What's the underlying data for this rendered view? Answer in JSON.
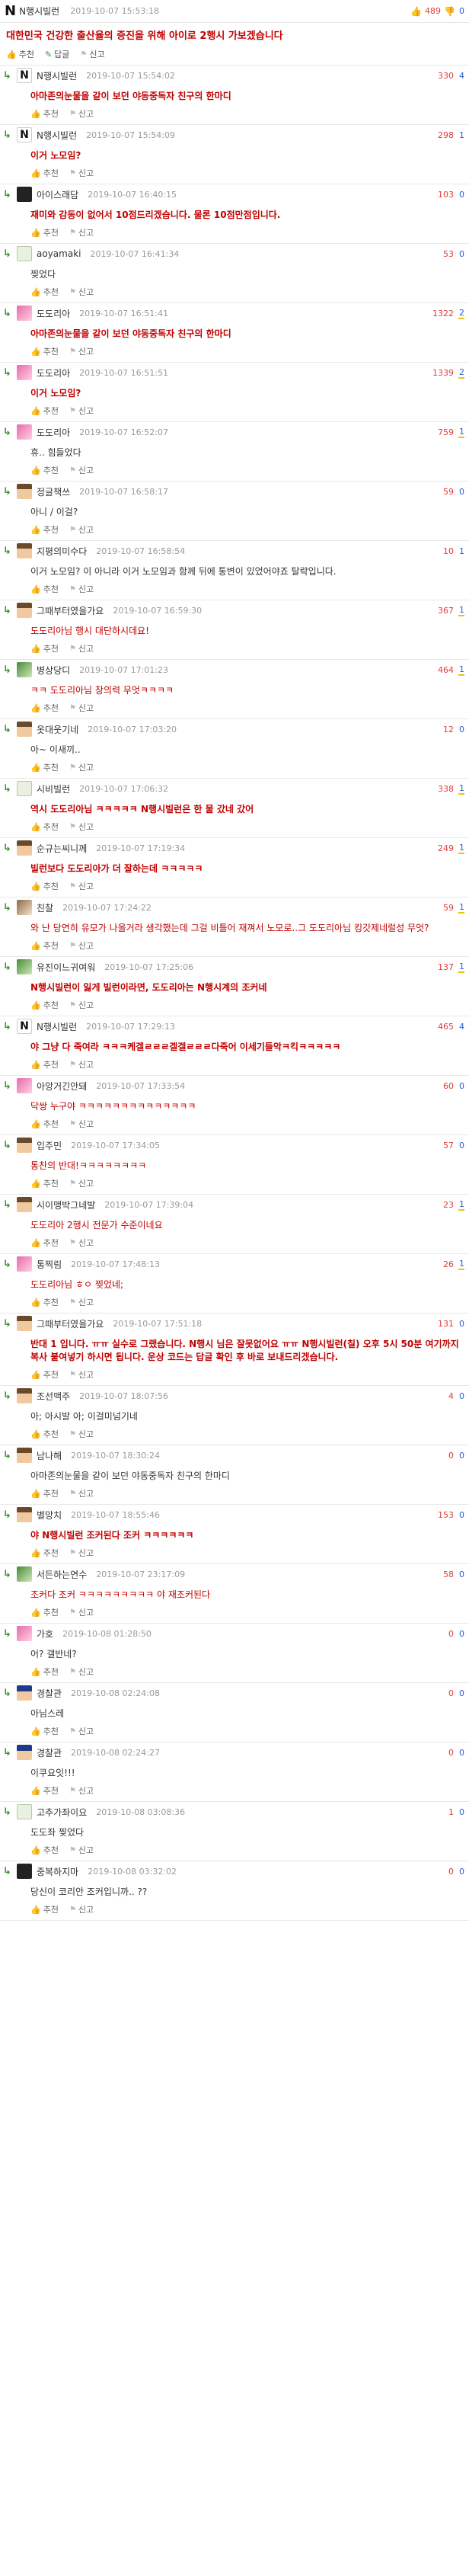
{
  "op": {
    "icon_glyph": "N",
    "nick": "N행시빌런",
    "date": "2019-10-07 15:53:18",
    "up": "489",
    "down": "0",
    "title": "대한민국 건강한 출산율의 증진을 위해 아이로 2행시 가보겠습니다",
    "actions": {
      "recommend": "추천",
      "reply": "답글",
      "report": "신고"
    }
  },
  "labels": {
    "recommend": "추천",
    "report": "신고",
    "reply_arrow": "↳"
  },
  "comments": [
    {
      "nick": "N행시빌런",
      "date": "2019-10-07 15:54:02",
      "score": "330",
      "replies": "4",
      "hl": false,
      "avatar": "n",
      "style": "red",
      "text": "아마존의눈물을 같이 보던 야동중독자 친구의 한마디"
    },
    {
      "nick": "N행시빌런",
      "date": "2019-10-07 15:54:09",
      "score": "298",
      "replies": "1",
      "hl": false,
      "avatar": "n",
      "style": "red",
      "text": "이거 노모임?"
    },
    {
      "nick": "아이스래담",
      "date": "2019-10-07 16:40:15",
      "score": "103",
      "replies": "0",
      "hl": false,
      "avatar": "dark",
      "style": "red",
      "text": "재미와 감동이 없어서 10점드리겠습니다. 물론 10점만점입니다."
    },
    {
      "nick": "aoyamaki",
      "date": "2019-10-07 16:41:34",
      "score": "53",
      "replies": "0",
      "hl": false,
      "avatar": "leaf",
      "style": "plain",
      "text": "찢었다"
    },
    {
      "nick": "도도리아",
      "date": "2019-10-07 16:51:41",
      "score": "1322",
      "replies": "2",
      "hl": true,
      "avatar": "pink",
      "style": "red",
      "text": "아마존의눈물을 같이 보던 야동중독자 친구의 한마디"
    },
    {
      "nick": "도도리아",
      "date": "2019-10-07 16:51:51",
      "score": "1339",
      "replies": "2",
      "hl": true,
      "avatar": "pink",
      "style": "red",
      "text": "이거 노모임?"
    },
    {
      "nick": "도도리아",
      "date": "2019-10-07 16:52:07",
      "score": "759",
      "replies": "1",
      "hl": true,
      "avatar": "pink",
      "style": "plain",
      "text": "휴.. 힘들었다"
    },
    {
      "nick": "정글책쓰",
      "date": "2019-10-07 16:58:17",
      "score": "59",
      "replies": "0",
      "hl": false,
      "avatar": "face",
      "style": "plain",
      "text": "아니 / 이걸?"
    },
    {
      "nick": "지평의미수다",
      "date": "2019-10-07 16:58:54",
      "score": "10",
      "replies": "1",
      "hl": false,
      "avatar": "face",
      "style": "plain",
      "text": "이거 노모임? 이 아니라 이거 노모임과 함께 뒤에 통변이 있었어야죠 탈락입니다."
    },
    {
      "nick": "그때부터였을가요",
      "date": "2019-10-07 16:59:30",
      "score": "367",
      "replies": "1",
      "hl": true,
      "avatar": "face",
      "style": "redn",
      "text": "도도리아님 행시 대단하시데요!"
    },
    {
      "nick": "병상당디",
      "date": "2019-10-07 17:01:23",
      "score": "464",
      "replies": "1",
      "hl": true,
      "avatar": "green",
      "style": "redn",
      "text": "ㅋㅋ 도도리아님 창의력 무엇ㅋㅋㅋㅋ"
    },
    {
      "nick": "옷대웃기네",
      "date": "2019-10-07 17:03:20",
      "score": "12",
      "replies": "0",
      "hl": false,
      "avatar": "face",
      "style": "plain",
      "text": "아~ 이새끼.."
    },
    {
      "nick": "시비빌런",
      "date": "2019-10-07 17:06:32",
      "score": "338",
      "replies": "1",
      "hl": true,
      "avatar": "leaf",
      "style": "red",
      "text": "역시 도도리아님 ㅋㅋㅋㅋㅋ N행시빌런은 한 물 갔네 갔어"
    },
    {
      "nick": "순규는씨니께",
      "date": "2019-10-07 17:19:34",
      "score": "249",
      "replies": "1",
      "hl": true,
      "avatar": "face",
      "style": "red",
      "text": "빌런보다 도도리아가 더 잘하는데 ㅋㅋㅋㅋㅋ"
    },
    {
      "nick": "친찰",
      "date": "2019-10-07 17:24:22",
      "score": "59",
      "replies": "1",
      "hl": true,
      "avatar": "eye",
      "style": "redn",
      "text": "와 난 당연히 유모가 나올거라 생각했는데 그걸 비틀어 재껴서 노모로..그 도도리아님 킹갓제네럴성 무엇?"
    },
    {
      "nick": "유진이느귀여워",
      "date": "2019-10-07 17:25:06",
      "score": "137",
      "replies": "1",
      "hl": true,
      "avatar": "green",
      "style": "red",
      "text": "N행시빌런이 잃게 빌런이라면, 도도리아는 N행시계의 조커네"
    },
    {
      "nick": "N행시빌런",
      "date": "2019-10-07 17:29:13",
      "score": "465",
      "replies": "4",
      "hl": false,
      "avatar": "n",
      "style": "red",
      "text": "야 그냥 다 죽여라 ㅋㅋㅋ케겔ㄹㄹㄹ겔겔ㄹㄹㄹ다죽어 이세기들악ㅋ킥ㅋㅋㅋㅋㅋ"
    },
    {
      "nick": "아앙거긴안돼",
      "date": "2019-10-07 17:33:54",
      "score": "60",
      "replies": "0",
      "hl": false,
      "avatar": "pink",
      "style": "redn",
      "text": "닥쌍 누구야 ㅋㅋㅋㅋㅋㅋㅋㅋㅋㅋㅋㅋㅋㅋ"
    },
    {
      "nick": "입주민",
      "date": "2019-10-07 17:34:05",
      "score": "57",
      "replies": "0",
      "hl": false,
      "avatar": "face",
      "style": "redn",
      "text": "통찬의 반대!ㅋㅋㅋㅋㅋㅋㅋㅋ"
    },
    {
      "nick": "시이맹박그네발",
      "date": "2019-10-07 17:39:04",
      "score": "23",
      "replies": "1",
      "hl": true,
      "avatar": "face",
      "style": "redn",
      "text": "도도리아 2행시 전문가 수준이네요"
    },
    {
      "nick": "통찍림",
      "date": "2019-10-07 17:48:13",
      "score": "26",
      "replies": "1",
      "hl": true,
      "avatar": "pink",
      "style": "redn",
      "text": "도도리아님 ㅎㅇ 찢었네;"
    },
    {
      "nick": "그때부터였을가요",
      "date": "2019-10-07 17:51:18",
      "score": "131",
      "replies": "0",
      "hl": false,
      "avatar": "face",
      "style": "red",
      "text": "반대 1 입니다. ㅠㅠ 실수로 그랬습니다. N행시 님은 잘못없어요 ㅠㅠ N행시빌런(칠) 오후 5시 50분 여기까지 복사 붙여넣기 하시면 됩니다. 운상 코드는 답글 확인 후 바로 보내드리겠습니다."
    },
    {
      "nick": "조선맥주",
      "date": "2019-10-07 18:07:56",
      "score": "4",
      "replies": "0",
      "hl": false,
      "avatar": "face",
      "style": "plain",
      "text": "아; 아시발 아; 이걸미넘기네"
    },
    {
      "nick": "남나해",
      "date": "2019-10-07 18:30:24",
      "score": "0",
      "replies": "0",
      "hl": false,
      "avatar": "face",
      "style": "plain",
      "text": "아마존의눈물을 같이 보던 야동중독자 친구의 한마디"
    },
    {
      "nick": "별망치",
      "date": "2019-10-07 18:55:46",
      "score": "153",
      "replies": "0",
      "hl": false,
      "avatar": "face",
      "style": "red",
      "text": "야 N행시빌런 조커된다 조커 ㅋㅋㅋㅋㅋㅋ"
    },
    {
      "nick": "서든하는연수",
      "date": "2019-10-07 23:17:09",
      "score": "58",
      "replies": "0",
      "hl": false,
      "avatar": "green",
      "style": "redn",
      "text": "조커다 조커 ㅋㅋㅋㅋㅋㅋㅋㅋㅋ 야 재조커된다"
    },
    {
      "nick": "가호",
      "date": "2019-10-08 01:28:50",
      "score": "0",
      "replies": "0",
      "hl": false,
      "avatar": "pink",
      "style": "plain",
      "text": "어? 갤반네?"
    },
    {
      "nick": "경찰관",
      "date": "2019-10-08 02:24:08",
      "score": "0",
      "replies": "0",
      "hl": false,
      "avatar": "blue",
      "style": "plain",
      "text": "아님스레"
    },
    {
      "nick": "경찰관",
      "date": "2019-10-08 02:24:27",
      "score": "0",
      "replies": "0",
      "hl": false,
      "avatar": "blue",
      "style": "plain",
      "text": "이쿠요잇!!!"
    },
    {
      "nick": "고추가좌이요",
      "date": "2019-10-08 03:08:36",
      "score": "1",
      "replies": "0",
      "hl": false,
      "avatar": "leaf",
      "style": "plain",
      "text": "도도좌 찢었다"
    },
    {
      "nick": "중복하지마",
      "date": "2019-10-08 03:32:02",
      "score": "0",
      "replies": "0",
      "hl": false,
      "avatar": "dark",
      "style": "plain",
      "text": "당신이 코리안 조커입니까.. ??"
    }
  ],
  "colors": {
    "accent_red": "#c00000",
    "score_red": "#e23b3b",
    "reply_blue": "#2b5fd0",
    "highlight": "#f2c300",
    "reply_green": "#3a8f3a"
  }
}
